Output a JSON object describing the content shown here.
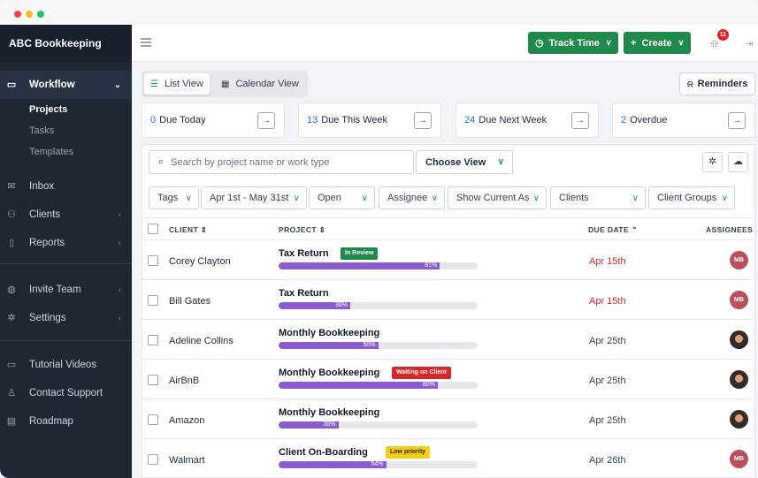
{
  "app": {
    "org_name": "ABC Bookkeeping"
  },
  "sidebar": {
    "workflow": {
      "label": "Workflow",
      "icon": "briefcase-icon"
    },
    "sub_items": [
      "Projects",
      "Tasks",
      "Templates"
    ],
    "items": [
      {
        "label": "Inbox",
        "icon": "mail-icon"
      },
      {
        "label": "Clients",
        "icon": "users-icon"
      },
      {
        "label": "Reports",
        "icon": "file-icon"
      },
      {
        "label": "Invite Team",
        "icon": "globe-icon"
      },
      {
        "label": "Settings",
        "icon": "gear-icon"
      },
      {
        "label": "Tutorial Videos",
        "icon": "video-icon"
      },
      {
        "label": "Contact Support",
        "icon": "person-icon"
      },
      {
        "label": "Roadmap",
        "icon": "map-icon"
      }
    ]
  },
  "topbar": {
    "track_time_label": "Track Time",
    "create_label": "Create",
    "notification_count": "11",
    "accent": "#1f8a4c"
  },
  "views": {
    "list_label": "List View",
    "calendar_label": "Calendar View",
    "reminders_label": "Reminders"
  },
  "summary": [
    {
      "count": "0",
      "label": "Due Today"
    },
    {
      "count": "13",
      "label": "Due This Week"
    },
    {
      "count": "24",
      "label": "Due Next Week"
    },
    {
      "count": "2",
      "label": "Overdue"
    }
  ],
  "search": {
    "placeholder": "Search by project name or work type",
    "choose_view_label": "Choose View"
  },
  "filters": [
    "Tags",
    "Apr 1st - May 31st",
    "Open",
    "Assignee",
    "Show Current As",
    "Clients",
    "Client Groups"
  ],
  "table": {
    "headers": {
      "client": "CLIENT",
      "project": "PROJECT",
      "due_date": "DUE DATE",
      "assignees": "ASSIGNEES"
    },
    "rows": [
      {
        "client": "Corey Clayton",
        "project": "Tax Return",
        "tag": "In Review",
        "tag_color": "#1f8a4c",
        "progress": 81,
        "progress_label": "81%",
        "due": "Apr 15th",
        "overdue": true,
        "assignee": "MB"
      },
      {
        "client": "Bill Gates",
        "project": "Tax Return",
        "tag": "",
        "tag_color": "",
        "progress": 36,
        "progress_label": "36%",
        "due": "Apr 15th",
        "overdue": true,
        "assignee": "MB"
      },
      {
        "client": "Adeline Collins",
        "project": "Monthly Bookkeeping",
        "tag": "",
        "tag_color": "",
        "progress": 50,
        "progress_label": "50%",
        "due": "Apr 25th",
        "overdue": false,
        "assignee": ""
      },
      {
        "client": "AirBnB",
        "project": "Monthly Bookkeeping",
        "tag": "Waiting on Client",
        "tag_color": "#dc2626",
        "progress": 80,
        "progress_label": "80%",
        "due": "Apr 25th",
        "overdue": false,
        "assignee": ""
      },
      {
        "client": "Amazon",
        "project": "Monthly Bookkeeping",
        "tag": "",
        "tag_color": "",
        "progress": 30,
        "progress_label": "30%",
        "due": "Apr 25th",
        "overdue": false,
        "assignee": ""
      },
      {
        "client": "Walmart",
        "project": "Client On-Boarding",
        "tag": "Low priority",
        "tag_color": "#facc15",
        "progress": 54,
        "progress_label": "54%",
        "due": "Apr 26th",
        "overdue": false,
        "assignee": "MB"
      }
    ]
  }
}
